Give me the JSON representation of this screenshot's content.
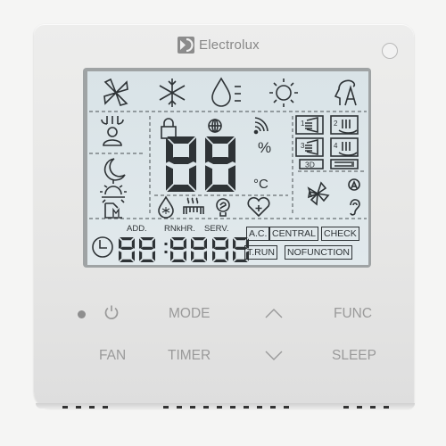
{
  "brand": {
    "name": "Electrolux",
    "logo_icon": "electrolux-logo-icon"
  },
  "lcd": {
    "top_row_icons": [
      "fan-mode-icon",
      "cool-snowflake-icon",
      "dry-drop-icon",
      "heat-sun-icon",
      "auto-head-icon"
    ],
    "left_icons": [
      "airflow-person-icon",
      "sleep-moon-icon",
      "sunrise-icon",
      "memory-m-icon"
    ],
    "center_icons": [
      "lock-icon",
      "globe-icon",
      "wifi-signal-icon"
    ],
    "main_digits": "88",
    "percent_unit": "%",
    "temp_unit": "°C",
    "bottom_center_icons": [
      "anti-freeze-drop-icon",
      "heater-icon",
      "eco-bulb-icon",
      "health-heart-icon"
    ],
    "swing_boxes": [
      "1",
      "2",
      "3",
      "4"
    ],
    "swing_3d_label": "3D",
    "right_icons": [
      "fan-speed-icon",
      "auto-a-icon",
      "ear-silent-icon"
    ],
    "clock_icon": "clock-icon",
    "time_labels": {
      "add": "ADD.",
      "rnkhr": "RNkHR.",
      "serv": "SERV."
    },
    "time_digits": {
      "left": "88",
      "middle": "88",
      "right": "88"
    },
    "status_boxes": {
      "ac": "A.C.",
      "central": "CENTRAL",
      "check": "CHECK",
      "trun": "T.RUN",
      "nofunction": "NOFUNCTION"
    }
  },
  "buttons": {
    "power": "power-icon",
    "mode": "MODE",
    "up": "up-chevron-icon",
    "func": "FUNC",
    "fan": "FAN",
    "timer": "TIMER",
    "down": "down-chevron-icon",
    "sleep": "SLEEP"
  }
}
